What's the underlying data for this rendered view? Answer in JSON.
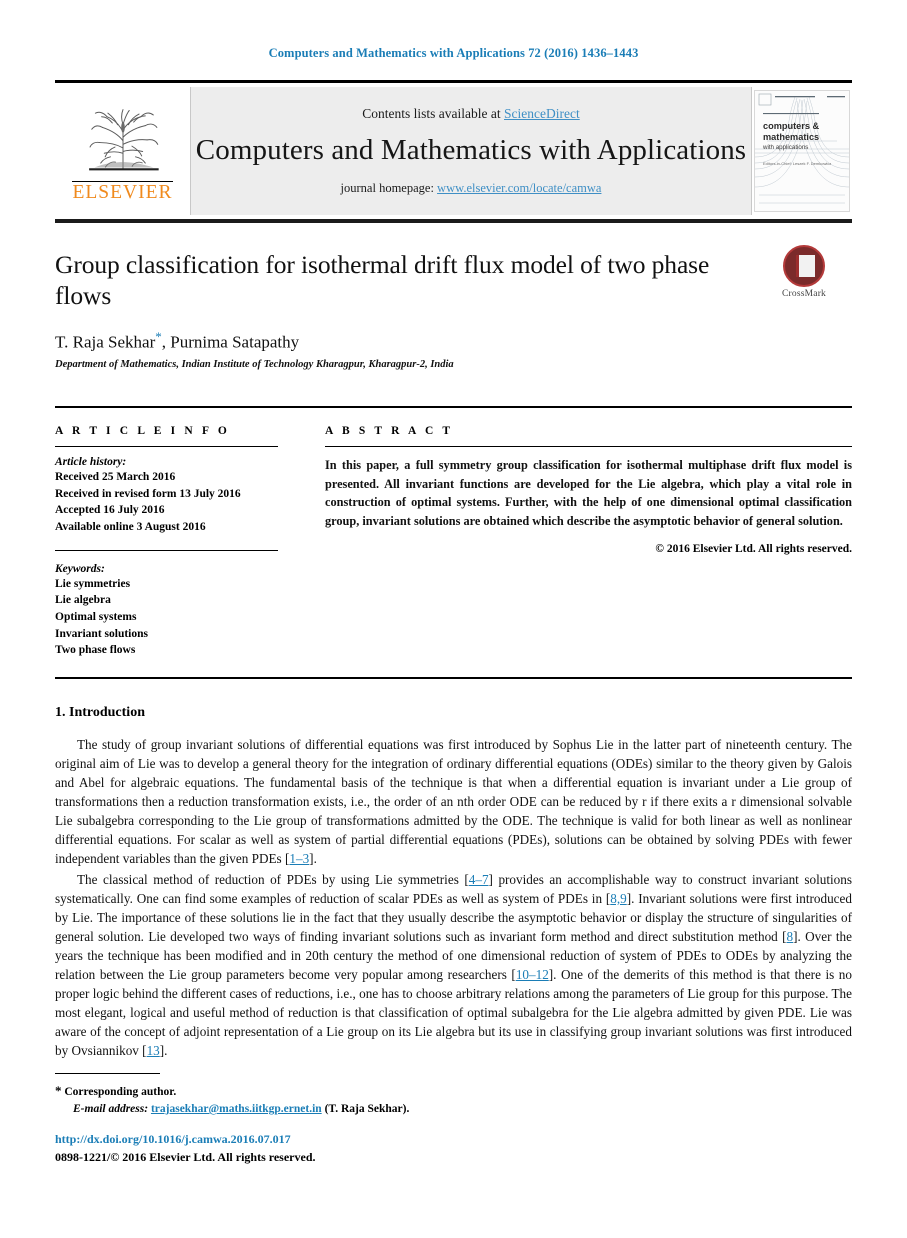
{
  "running_head": "Computers and Mathematics with Applications 72 (2016) 1436–1443",
  "masthead": {
    "publisher_name": "ELSEVIER",
    "contents_prefix": "Contents lists available at ",
    "contents_link": "ScienceDirect",
    "journal_title": "Computers and Mathematics with Applications",
    "homepage_prefix": "journal homepage: ",
    "homepage_link": "www.elsevier.com/locate/camwa",
    "cover_line_1": "computers &",
    "cover_line_2": "mathematics",
    "cover_line_3": "with applications"
  },
  "article": {
    "title": "Group classification for isothermal drift flux model of two phase flows",
    "authors": "T. Raja Sekhar",
    "author_marker": "*",
    "authors_rest": ", Purnima Satapathy",
    "affiliation": "Department of Mathematics, Indian Institute of Technology Kharagpur, Kharagpur-2, India",
    "crossmark_label": "CrossMark"
  },
  "info": {
    "heading": "A R T I C L E   I N F O",
    "history_label": "Article history:",
    "history": [
      "Received 25 March 2016",
      "Received in revised form 13 July 2016",
      "Accepted 16 July 2016",
      "Available online 3 August 2016"
    ],
    "keywords_label": "Keywords:",
    "keywords": [
      "Lie symmetries",
      "Lie algebra",
      "Optimal systems",
      "Invariant solutions",
      "Two phase flows"
    ]
  },
  "abstract": {
    "heading": "A B S T R A C T",
    "text": "In this paper, a full symmetry group classification for isothermal multiphase drift flux model is presented. All invariant functions are developed for the Lie algebra, which play a vital role in construction of optimal systems. Further, with the help of one dimensional optimal classification group, invariant solutions are obtained which describe the asymptotic behavior of general solution.",
    "copyright": "© 2016 Elsevier Ltd. All rights reserved."
  },
  "introduction": {
    "heading": "1. Introduction",
    "paragraph_1_a": "The study of group invariant solutions of differential equations was first introduced by Sophus Lie in the latter part of nineteenth century. The original aim of Lie was to develop a general theory for the integration of ordinary differential equations (ODEs) similar to the theory given by Galois and Abel for algebraic equations. The fundamental basis of the technique is that when a differential equation is invariant under a Lie group of transformations then a reduction transformation exists, i.e., the order of an nth order ODE can be reduced by r if there exits a r dimensional solvable Lie subalgebra corresponding to the Lie group of transformations admitted by the ODE. The technique is valid for both linear as well as nonlinear differential equations. For scalar as well as system of partial differential equations (PDEs), solutions can be obtained by solving PDEs with fewer independent variables than the given PDEs [",
    "ref_1": "1–3",
    "paragraph_1_b": "].",
    "paragraph_2_a": "The classical method of reduction of PDEs by using Lie symmetries [",
    "ref_2": "4–7",
    "paragraph_2_b": "] provides an accomplishable way to construct invariant solutions systematically. One can find some examples of reduction of scalar PDEs as well as system of PDEs in [",
    "ref_3": "8,9",
    "paragraph_2_c": "]. Invariant solutions were first introduced by Lie. The importance of these solutions lie in the fact that they usually describe the asymptotic behavior or display the structure of singularities of general solution. Lie developed two ways of finding invariant solutions such as invariant form method and direct substitution method [",
    "ref_4": "8",
    "paragraph_2_d": "]. Over the years the technique has been modified and in 20th century the method of one dimensional reduction of system of PDEs to ODEs by analyzing the relation between the Lie group parameters become very popular among researchers [",
    "ref_5": "10–12",
    "paragraph_2_e": "]. One of the demerits of this method is that there is no proper logic behind the different cases of reductions, i.e., one has to choose arbitrary relations among the parameters of Lie group for this purpose. The most elegant, logical and useful method of reduction is that classification of optimal subalgebra for the Lie algebra admitted by given PDE. Lie was aware of the concept of adjoint representation of a Lie group on its Lie algebra but its use in classifying group invariant solutions was first introduced by Ovsiannikov [",
    "ref_6": "13",
    "paragraph_2_f": "]."
  },
  "footer": {
    "corresponding_marker": "*",
    "corresponding_text": "Corresponding author.",
    "email_label": "E-mail address:",
    "email": "trajasekhar@maths.iitkgp.ernet.in",
    "email_suffix": "(T. Raja Sekhar).",
    "doi": "http://dx.doi.org/10.1016/j.camwa.2016.07.017",
    "issn": "0898-1221/© 2016 Elsevier Ltd. All rights reserved."
  },
  "colors": {
    "link": "#1a7db6",
    "elsevier_orange": "#f08a1d",
    "masthead_bg": "#ededed"
  }
}
